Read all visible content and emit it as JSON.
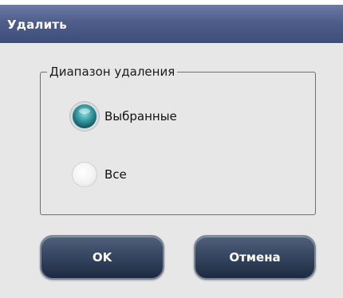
{
  "dialog": {
    "title": "Удалить"
  },
  "group": {
    "legend": "Диапазон удаления",
    "options": [
      {
        "label": "Выбранные",
        "checked": true
      },
      {
        "label": "Все",
        "checked": false
      }
    ]
  },
  "buttons": {
    "ok_label": "OK",
    "cancel_label": "Отмена"
  },
  "colors": {
    "titlebar": "#4e5d8a",
    "dialog_bg": "#e7e7e7",
    "button": "#3a4a64",
    "radio_selected": "#2f8a92"
  }
}
